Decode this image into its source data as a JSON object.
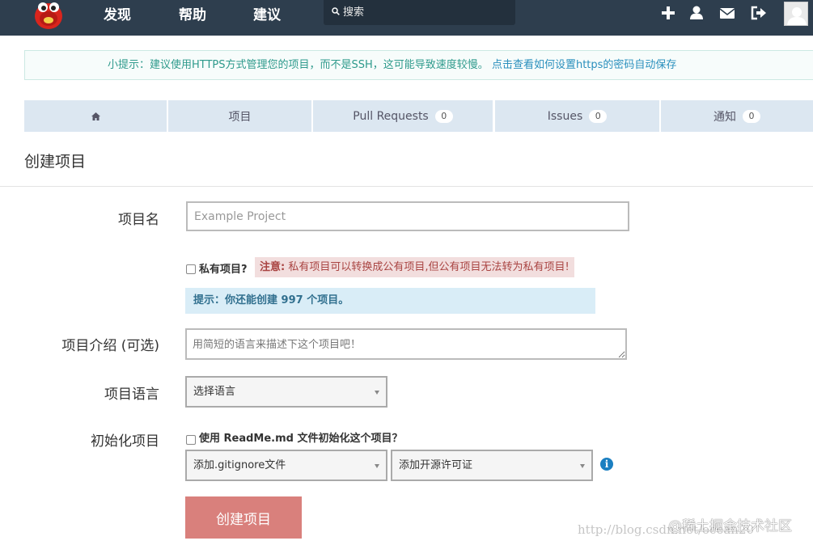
{
  "nav": {
    "links": [
      "发现",
      "帮助",
      "建议"
    ],
    "search_placeholder": "搜索",
    "icons": [
      "plus-icon",
      "user-icon",
      "envelope-icon",
      "sign-out-icon"
    ]
  },
  "tip": {
    "text": "小提示：建议使用HTTPS方式管理您的项目，而不是SSH，这可能导致速度较慢。",
    "link": "点击查看如何设置https的密码自动保存"
  },
  "tabs": [
    {
      "label": "",
      "icon": "home-icon"
    },
    {
      "label": "项目"
    },
    {
      "label": "Pull Requests",
      "count": "0"
    },
    {
      "label": "Issues",
      "count": "0"
    },
    {
      "label": "通知",
      "count": "0"
    }
  ],
  "page_title": "创建项目",
  "form": {
    "name_label": "项目名",
    "name_placeholder": "Example Project",
    "private_label": "私有项目?",
    "warning_prefix": "注意:",
    "warning_text": "私有项目可以转换成公有项目,但公有项目无法转为私有项目!",
    "quota_tip": "提示：你还能创建 997 个项目。",
    "desc_label": "项目介绍 (可选)",
    "desc_placeholder": "用简短的语言来描述下这个项目吧！",
    "lang_label": "项目语言",
    "lang_select": "选择语言",
    "init_label": "初始化项目",
    "readme_label": "使用 ReadMe.md 文件初始化这个项目？",
    "gitignore_select": "添加.gitignore文件",
    "license_select": "添加开源许可证",
    "submit": "创建项目"
  },
  "watermark": {
    "text": "@稀土掘金技术社区",
    "url": "http://blog.csdn.net/ocean20"
  }
}
